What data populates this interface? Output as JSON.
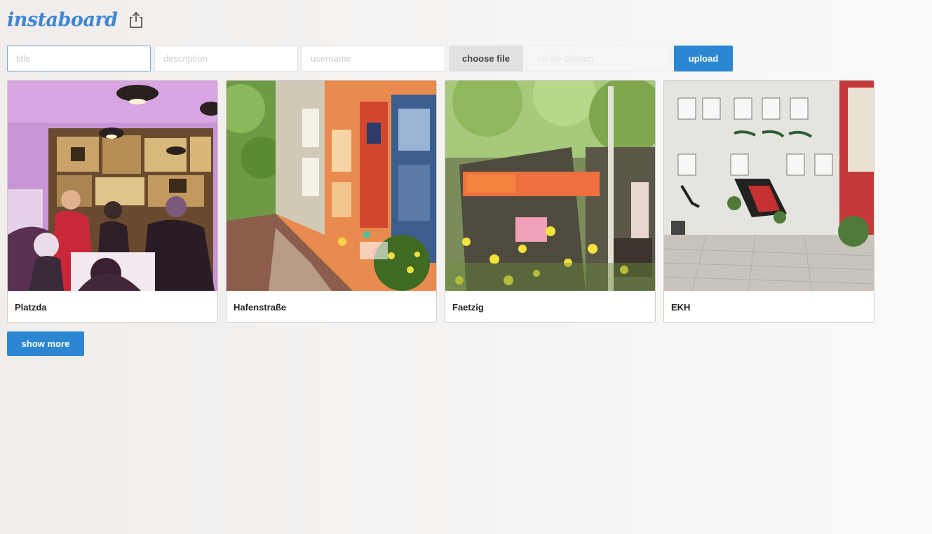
{
  "header": {
    "logo": "instaboard",
    "share_icon": "share-upload-icon"
  },
  "form": {
    "title_placeholder": "title",
    "description_placeholder": "description",
    "username_placeholder": "username",
    "choose_file_label": "choose file",
    "file_status": "no file chosen",
    "upload_label": "upload"
  },
  "cards": [
    {
      "title": "Platzda"
    },
    {
      "title": "Hafenstraße"
    },
    {
      "title": "Faetzig"
    },
    {
      "title": "EKH"
    }
  ],
  "show_more_label": "show more",
  "colors": {
    "accent": "#2b87d1",
    "logo": "#3f86d4"
  }
}
